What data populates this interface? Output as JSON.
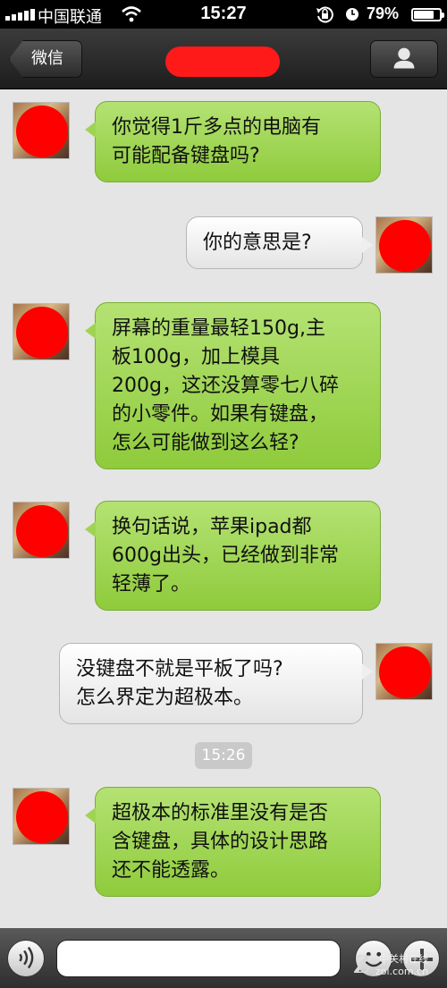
{
  "status_bar": {
    "carrier": "中国联通",
    "time": "15:27",
    "battery_percent": "79%",
    "battery_level": 0.79,
    "signal_bars": 5,
    "icons": [
      "signal-icon",
      "wifi-icon",
      "rotation-lock-icon",
      "alarm-icon",
      "battery-icon"
    ]
  },
  "nav": {
    "back_label": "微信",
    "title_redacted": true,
    "right_icon": "person-icon"
  },
  "messages": [
    {
      "side": "left",
      "text": "你觉得1斤多点的电脑有\n可能配备键盘吗?"
    },
    {
      "side": "right",
      "text": "你的意思是?"
    },
    {
      "side": "left",
      "text": "屏幕的重量最轻150g,主\n板100g，加上模具\n200g，这还没算零七八碎\n的小零件。如果有键盘，\n怎么可能做到这么轻?"
    },
    {
      "side": "left",
      "text": "换句话说，苹果ipad都\n600g出头，已经做到非常\n轻薄了。"
    },
    {
      "side": "right",
      "text": "没键盘不就是平板了吗?\n怎么界定为超极本。"
    },
    {
      "side": "left",
      "text": "超极本的标准里没有是否\n含键盘，具体的设计思路\n还不能透露。"
    }
  ],
  "timestamp": "15:26",
  "input_bar": {
    "value": "",
    "placeholder": "",
    "icons": [
      "voice-icon",
      "emoji-icon",
      "plus-icon"
    ]
  },
  "watermark": {
    "logo": "Z",
    "line1": "中关村在线",
    "line2": "zol.com.cn"
  },
  "colors": {
    "incoming_bubble": "#9fd452",
    "outgoing_bubble": "#efefef",
    "nav_bar": "#2b2b2b",
    "background": "#e5e5e5",
    "redaction": "#ff0000"
  }
}
